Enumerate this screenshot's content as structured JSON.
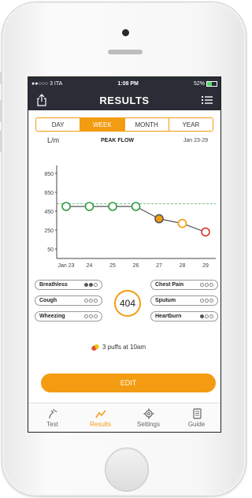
{
  "status_bar": {
    "carrier": "●●○○○ 3 ITA",
    "time": "1:08 PM",
    "battery": "52%"
  },
  "nav": {
    "title": "RESULTS"
  },
  "segments": [
    {
      "label": "DAY"
    },
    {
      "label": "WEEK"
    },
    {
      "label": "MONTH"
    },
    {
      "label": "YEAR"
    }
  ],
  "active_segment": "WEEK",
  "chart_data": {
    "type": "line",
    "title": "PEAK FLOW",
    "unit_label": "L/m",
    "date_range": "Jan 23-29",
    "categories": [
      "Jan 23",
      "24",
      "25",
      "26",
      "27",
      "28",
      "29"
    ],
    "y_ticks": [
      "850",
      "650",
      "450",
      "250",
      "50"
    ],
    "ylim": [
      50,
      850
    ],
    "target_line": 530,
    "series": [
      {
        "values": [
          500,
          500,
          500,
          500,
          370,
          320,
          230
        ]
      }
    ],
    "point_colors": [
      "#2e9e3e",
      "#2e9e3e",
      "#2e9e3e",
      "#2e9e3e",
      "#f39c12",
      "#f39c12",
      "#d9342b"
    ],
    "grid": false
  },
  "symptoms_left": [
    {
      "label": "Breathless",
      "filled": 2
    },
    {
      "label": "Cough",
      "filled": 0
    },
    {
      "label": "Wheezing",
      "filled": 0
    }
  ],
  "symptoms_right": [
    {
      "label": "Chest Pain",
      "filled": 0
    },
    {
      "label": "Sputum",
      "filled": 0
    },
    {
      "label": "Heartburn",
      "filled": 1
    }
  ],
  "score": "404",
  "puffs": "3 puffs at 10am",
  "edit_label": "EDIT",
  "tabs": [
    {
      "label": "Test",
      "icon": "test-icon"
    },
    {
      "label": "Results",
      "icon": "chart-icon"
    },
    {
      "label": "Settings",
      "icon": "gear-icon"
    },
    {
      "label": "Guide",
      "icon": "book-icon"
    }
  ],
  "colors": {
    "accent": "#f39c12",
    "nav_bg": "#2a2c36",
    "good": "#2e9e3e",
    "bad": "#d9342b"
  }
}
